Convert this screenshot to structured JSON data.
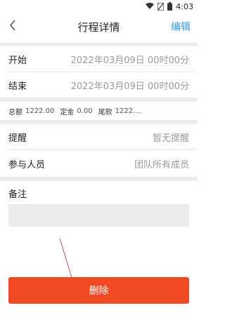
{
  "status_bar": {
    "time": "4:03"
  },
  "header": {
    "title": "行程详情",
    "edit_label": "编辑"
  },
  "schedule": {
    "start": {
      "label": "开始",
      "value": "2022年03月09日 00时00分"
    },
    "end": {
      "label": "结束",
      "value": "2022年03月09日 00时00分"
    }
  },
  "amounts": {
    "total_label": "总额",
    "total_value": "1222.00",
    "deposit_label": "定金",
    "deposit_value": "0.00",
    "balance_label": "尾款",
    "balance_value": "1222...."
  },
  "reminder": {
    "label": "提醒",
    "value": "暂无提醒"
  },
  "participants": {
    "label": "参与人员",
    "value": "团队所有成员"
  },
  "notes": {
    "label": "备注",
    "value": ""
  },
  "delete_label": "删除",
  "colors": {
    "accent": "#2d9be6",
    "danger": "#f04a23",
    "band": "#ececec"
  }
}
